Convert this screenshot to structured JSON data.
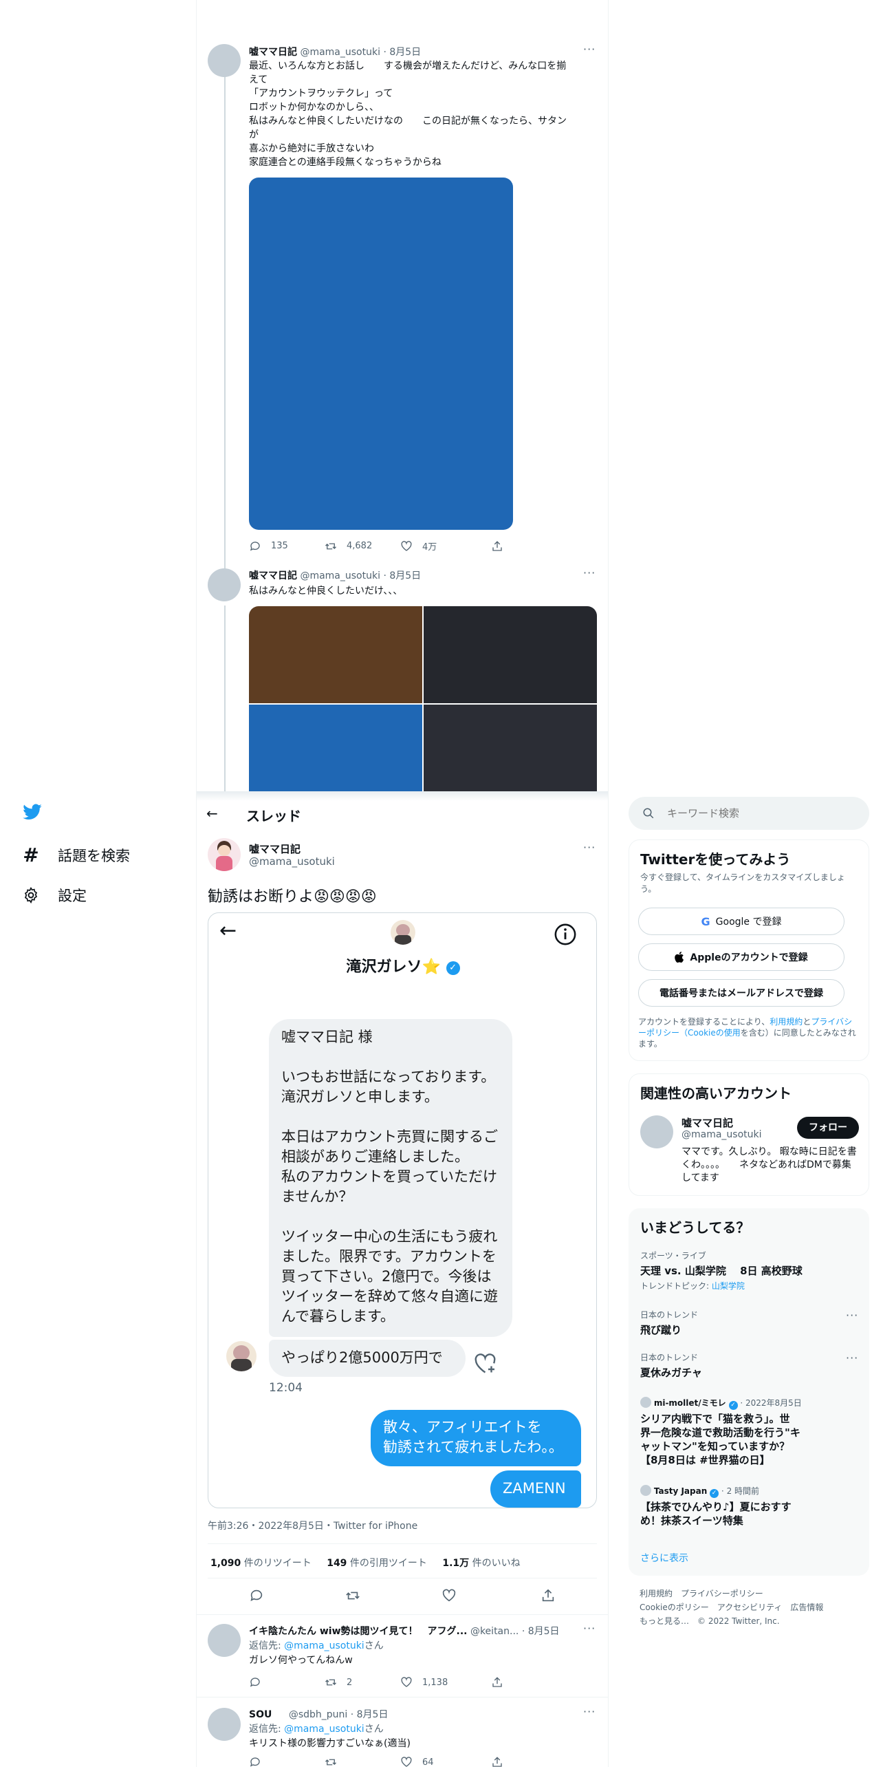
{
  "nav": {
    "explore_label": "話題を検索",
    "settings_label": "設定"
  },
  "timeline": {
    "tweet1": {
      "name": "嘘ママ日記",
      "handle": "@mama_usotuki",
      "date": "8月5日",
      "lines": [
        "最近、いろんな方とお話し　　する機会が増えたんだけど、みんな口を揃",
        "えて",
        "「アカウントヲウッテクレ」って",
        "ロボットか何かなのかしら、、",
        "私はみんなと仲良くしたいだけなの　　この日記が無くなったら、サタン",
        "が",
        "喜ぶから絶対に手放さないわ",
        "家庭連合との連絡手段無くなっちゃうからね"
      ],
      "replies": "135",
      "retweets": "4,682",
      "likes": "4万"
    },
    "tweet2": {
      "name": "嘘ママ日記",
      "handle": "@mama_usotuki",
      "date": "8月5日",
      "text": "私はみんなと仲良くしたいだけ、、、"
    }
  },
  "thread": {
    "header_title": "スレッド",
    "author_name": "嘘ママ日記",
    "author_handle": "@mama_usotuki",
    "tweet_text": "勧誘はお断りよ😡😡😡😡",
    "dm": {
      "contact_name": "滝沢ガレソ⭐",
      "message_lines": [
        "嘘ママ日記 様",
        "",
        "いつもお世話になっております。",
        "滝沢ガレソと申します。",
        "",
        "本日はアカウント売買に関するご",
        "相談がありご連絡しました。",
        "私のアカウントを買っていただけ",
        "ませんか？",
        "",
        "ツイッター中心の生活にもう疲れ",
        "ました。限界です。アカウントを",
        "買って下さい。2億円で。今後は",
        "ツイッターを辞めて悠々自適に遊",
        "んで暮らします。"
      ],
      "second_message": "やっぱり2億5000万円で",
      "time": "12:04",
      "reply_lines": [
        "散々、アフィリエイトを",
        "勧誘されて疲れましたわ。。"
      ],
      "reply2": "ZAMENN"
    },
    "timestamp": "午前3:26・2022年8月5日・Twitter for iPhone",
    "stats": {
      "retweets_num": "1,090",
      "retweets_label": "件のリツイート",
      "quotes_num": "149",
      "quotes_label": "件の引用ツイート",
      "likes_num": "1.1万",
      "likes_label": "件のいいね"
    }
  },
  "replies": [
    {
      "name": "イキ陰たんたん wiw勢は閲ツイ見て！　アフグ...",
      "handle": "@keitan...",
      "date": "8月5日",
      "reply_prefix": "返信先: ",
      "reply_to": "@mama_usotuki",
      "reply_suffix": "さん",
      "text": "ガレソ何やってんねんw",
      "retweets": "2",
      "likes": "1,138"
    },
    {
      "name": "SOU",
      "handle": "@sdbh_puni",
      "date": "8月5日",
      "reply_prefix": "返信先: ",
      "reply_to": "@mama_usotuki",
      "reply_suffix": "さん",
      "text": "キリスト様の影響力すごいなぁ(適当)",
      "likes": "64"
    }
  ],
  "sidebar": {
    "search_placeholder": "キーワード検索",
    "signup": {
      "title": "Twitterを使ってみよう",
      "subtitle": "今すぐ登録して、タイムラインをカスタマイズしましょう。",
      "google_label": "Google で登録",
      "apple_label": "Appleのアカウントで登録",
      "phone_label": "電話番号またはメールアドレスで登録",
      "terms_1": "アカウントを登録することにより、",
      "terms_link1": "利用規約",
      "terms_2": "と",
      "terms_link2": "プライバシーポリシー（Cookieの使用",
      "terms_3": "を含む）に同意したとみなされます。"
    },
    "relevant": {
      "title": "関連性の高いアカウント",
      "name": "嘘ママ日記",
      "handle": "@mama_usotuki",
      "follow_label": "フォロー",
      "bio": "ママです。久しぶり。 暇な時に日記を書くわ。。。。　　ネタなどあればDMで募集してます"
    },
    "trends": {
      "title": "いまどうしてる？",
      "items": [
        {
          "label": "スポーツ・ライブ",
          "title": "天理 vs. 山梨学院　 8日 高校野球",
          "topic_prefix": "トレンドトピック: ",
          "topic": "山梨学院"
        },
        {
          "label": "日本のトレンド",
          "title": "飛び蹴り"
        },
        {
          "label": "日本のトレンド",
          "title": "夏休みガチャ"
        }
      ],
      "news1": {
        "source": "mi-mollet/ミモレ",
        "date": "2022年8月5日",
        "lines": [
          "シリア内戦下で「猫を救う」。世",
          "界一危険な道で救助活動を行う\"キ",
          "ャットマン\"を知っていますか？",
          "【8月8日は #世界猫の日】"
        ]
      },
      "news2": {
        "source": "Tasty Japan",
        "date": "2 時間前",
        "lines": [
          "【抹茶でひんやり♪】夏におすす",
          "め！抹茶スイーツ特集"
        ]
      },
      "show_more": "さらに表示"
    },
    "footer": {
      "line1": "利用規約　プライバシーポリシー",
      "line2": "Cookieのポリシー　アクセシビリティ　広告情報",
      "line3": "もっと見る…　© 2022 Twitter, Inc."
    }
  },
  "colors": {
    "accent": "#1d9bf0",
    "image_blue": "#1f67b4",
    "image_brown": "#5e3d22",
    "image_dark": "#25272d"
  }
}
